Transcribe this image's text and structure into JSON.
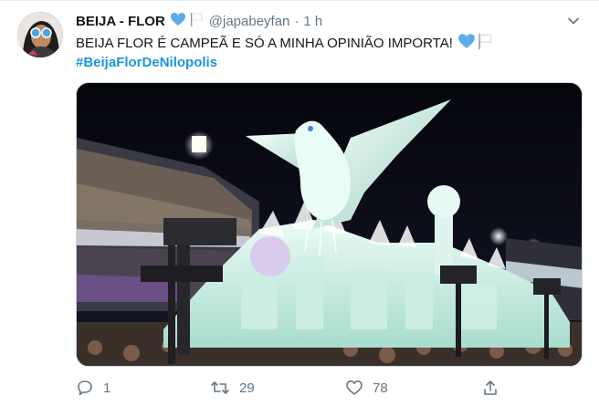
{
  "tweet": {
    "display_name": "BEIJA - FLOR",
    "handle": "@japabeyfan",
    "separator": "·",
    "time": "1 h",
    "text": "BEIJA FLOR É CAMPEÃ E SÓ A MINHA OPINIÃO IMPORTA!",
    "hashtag": "#BeijaFlorDeNilopolis",
    "media": {},
    "actions": {
      "reply_count": "1",
      "retweet_count": "29",
      "like_count": "78"
    }
  },
  "colors": {
    "accent": "#1b95e0",
    "muted": "#657786",
    "text": "#14171a",
    "heart_emoji": "#5dadec"
  },
  "icons": [
    "blue-heart-icon",
    "white-flag-icon",
    "chevron-down-icon",
    "reply-icon",
    "retweet-icon",
    "like-icon",
    "share-icon"
  ]
}
